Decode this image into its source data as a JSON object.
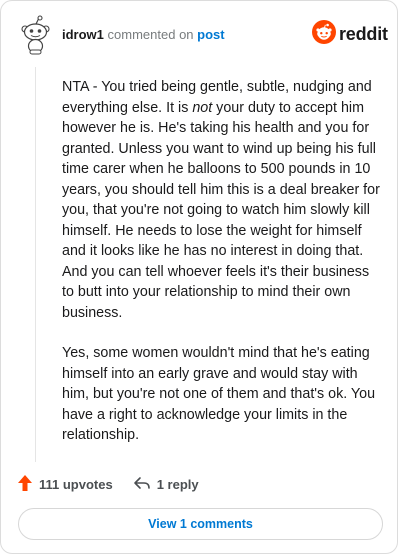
{
  "comment": {
    "username": "idrow1",
    "verb": "commented on",
    "post_link": "post",
    "paragraphs": [
      {
        "before": "NTA - You tried being gentle, subtle, nudging and everything else. It is ",
        "emphasis": "not",
        "after": " your duty to accept him however he is. He's taking his health and you for granted. Unless you want to wind up being his full time carer when he balloons to 500 pounds in 10 years, you should tell him this is a deal breaker for you, that you're not going to watch him slowly kill himself. He needs to lose the weight for himself and it looks like he has no interest in doing that. And you can tell whoever feels it's their business to butt into your relationship to mind their own business."
      },
      {
        "text": "Yes, some women wouldn't mind that he's eating himself into an early grave and would stay with him, but you're not one of them and that's ok. You have a right to acknowledge your limits in the relationship."
      }
    ]
  },
  "brand": {
    "wordmark": "reddit",
    "color": "#ff4500"
  },
  "footer": {
    "upvotes_label": "111 upvotes",
    "replies_label": "1 reply",
    "upvote_color": "#ff4500"
  },
  "view_button_label": "View 1 comments",
  "icons": {
    "avatar": "snoo-avatar-icon",
    "logo": "reddit-logo-icon",
    "upvote": "upvote-arrow-icon",
    "reply": "reply-arrow-icon"
  }
}
